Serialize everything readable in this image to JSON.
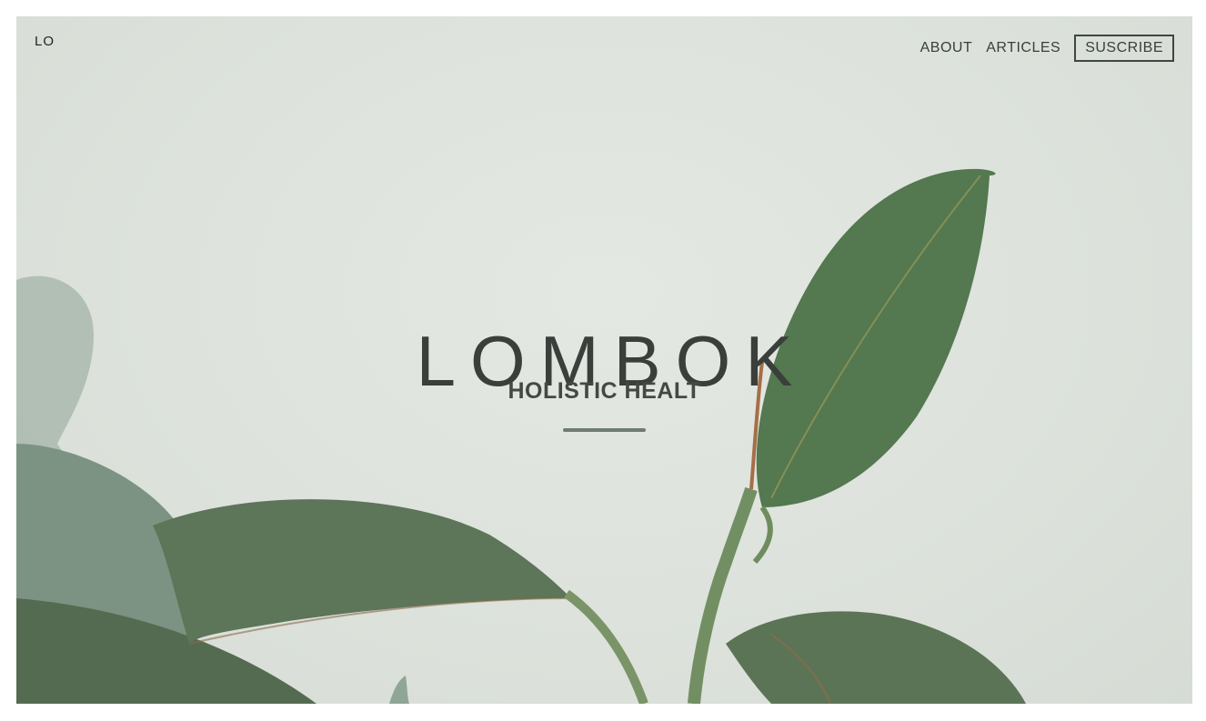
{
  "brand": {
    "short_logo": "LO"
  },
  "nav": {
    "about": "ABOUT",
    "articles": "ARTICLES",
    "subscribe": "SUSCRIBE"
  },
  "hero": {
    "title": "LOMBOK",
    "subtitle": "HOLISTIC HEALT",
    "background_image": "plant-leaves-icon"
  },
  "colors": {
    "background": "#dde2dc",
    "text": "#3b3f3b",
    "accent_rule": "#6f7b73",
    "leaf_dark": "#4e6a4a",
    "leaf_light": "#8fa595"
  }
}
